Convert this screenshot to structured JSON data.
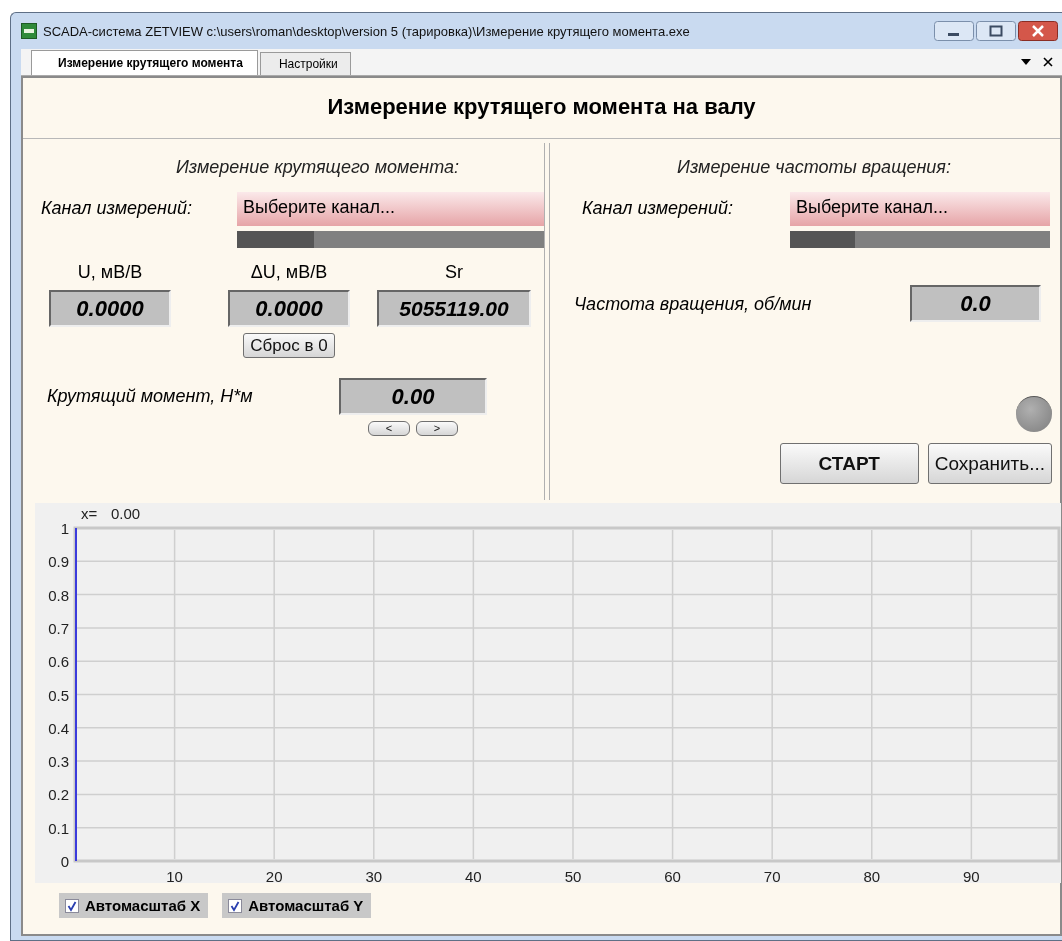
{
  "window": {
    "title": "SCADA-система ZETVIEW c:\\users\\roman\\desktop\\version 5 (тарировка)\\Измерение крутящего момента.exe"
  },
  "tabs": [
    {
      "label": "Измерение крутящего момента",
      "selected": true
    },
    {
      "label": "Настройки",
      "selected": false
    }
  ],
  "heading": "Измерение крутящего момента на валу",
  "torque_panel": {
    "title": "Измерение крутящего момента:",
    "channel_label": "Канал измерений:",
    "channel_select": {
      "value": "Выберите канал..."
    },
    "channel_signal": {
      "level": 0.25
    },
    "readings": [
      {
        "label": "U, мВ/В",
        "value": "0.0000"
      },
      {
        "label": "ΔU, мВ/В",
        "value": "0.0000"
      },
      {
        "label": "Sr",
        "value": "5055119.00"
      }
    ],
    "reset_button": "Сброс в 0",
    "torque_label": "Крутящий момент, Н*м",
    "torque_value": "0.00",
    "step_buttons": [
      "<",
      ">"
    ]
  },
  "speed_panel": {
    "title": "Измерение частоты вращения:",
    "channel_label": "Канал измерений:",
    "channel_select": {
      "value": "Выберите канал..."
    },
    "channel_signal": {
      "level": 0.25
    },
    "speed_label": "Частота вращения, об/мин",
    "speed_value": "0.0",
    "indicator": {
      "on": false
    },
    "buttons": [
      {
        "label": "СТАРТ",
        "bold": true
      },
      {
        "label": "Сохранить...",
        "bold": false
      }
    ]
  },
  "chart": {
    "cursor_label": "x=",
    "cursor_value": "0.00",
    "chart_data": {
      "type": "line",
      "grid": true,
      "xlim": [
        0,
        99
      ],
      "ylim": [
        0,
        1
      ],
      "xticks": [
        10,
        20,
        30,
        40,
        50,
        60,
        70,
        80,
        90
      ],
      "yticks": [
        0,
        0.1,
        0.2,
        0.3,
        0.4,
        0.5,
        0.6,
        0.7,
        0.8,
        0.9,
        1
      ]
    }
  },
  "autoscale": [
    {
      "label": "Автомасштаб X",
      "checked": true
    },
    {
      "label": "Автомасштаб Y",
      "checked": true
    }
  ]
}
